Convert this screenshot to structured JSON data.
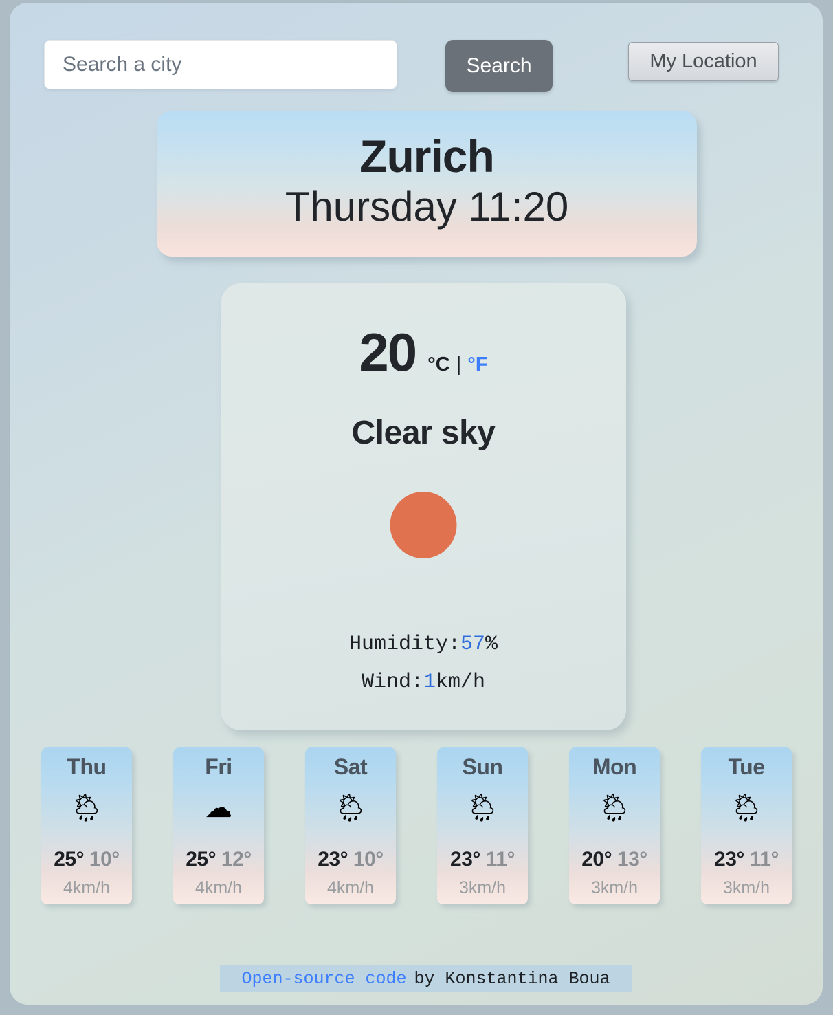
{
  "search": {
    "placeholder": "Search a city",
    "value": "",
    "search_button_label": "Search",
    "my_location_button_label": "My Location"
  },
  "header": {
    "city": "Zurich",
    "datetime": "Thursday 11:20"
  },
  "current": {
    "temperature": "20",
    "unit_celsius": "°C",
    "unit_separator": "|",
    "unit_fahrenheit": "°F",
    "condition": "Clear sky",
    "icon": "sun-icon",
    "humidity_label": "Humidity:",
    "humidity_value": "57",
    "humidity_suffix": "%",
    "wind_label": "Wind:",
    "wind_value": "1",
    "wind_suffix": "km/h"
  },
  "forecast": [
    {
      "day": "Thu",
      "icon": "🌦",
      "icon_name": "sun-behind-rain-cloud-icon",
      "temp_max": "25°",
      "temp_min": "10°",
      "wind": "4km/h"
    },
    {
      "day": "Fri",
      "icon": "☁",
      "icon_name": "cloud-icon",
      "temp_max": "25°",
      "temp_min": "12°",
      "wind": "4km/h"
    },
    {
      "day": "Sat",
      "icon": "🌦",
      "icon_name": "sun-behind-rain-cloud-icon",
      "temp_max": "23°",
      "temp_min": "10°",
      "wind": "4km/h"
    },
    {
      "day": "Sun",
      "icon": "🌦",
      "icon_name": "sun-behind-rain-cloud-icon",
      "temp_max": "23°",
      "temp_min": "11°",
      "wind": "3km/h"
    },
    {
      "day": "Mon",
      "icon": "🌦",
      "icon_name": "sun-behind-rain-cloud-icon",
      "temp_max": "20°",
      "temp_min": "13°",
      "wind": "3km/h"
    },
    {
      "day": "Tue",
      "icon": "🌦",
      "icon_name": "sun-behind-rain-cloud-icon",
      "temp_max": "23°",
      "temp_min": "11°",
      "wind": "3km/h"
    }
  ],
  "footer": {
    "link_text": "Open-source code",
    "credit_text": "by Konstantina Boua"
  },
  "colors": {
    "accent_blue": "#3d7eff",
    "sun_orange": "#e0724f",
    "search_button": "#6b7178",
    "footer_band": "#bdd4e3"
  }
}
